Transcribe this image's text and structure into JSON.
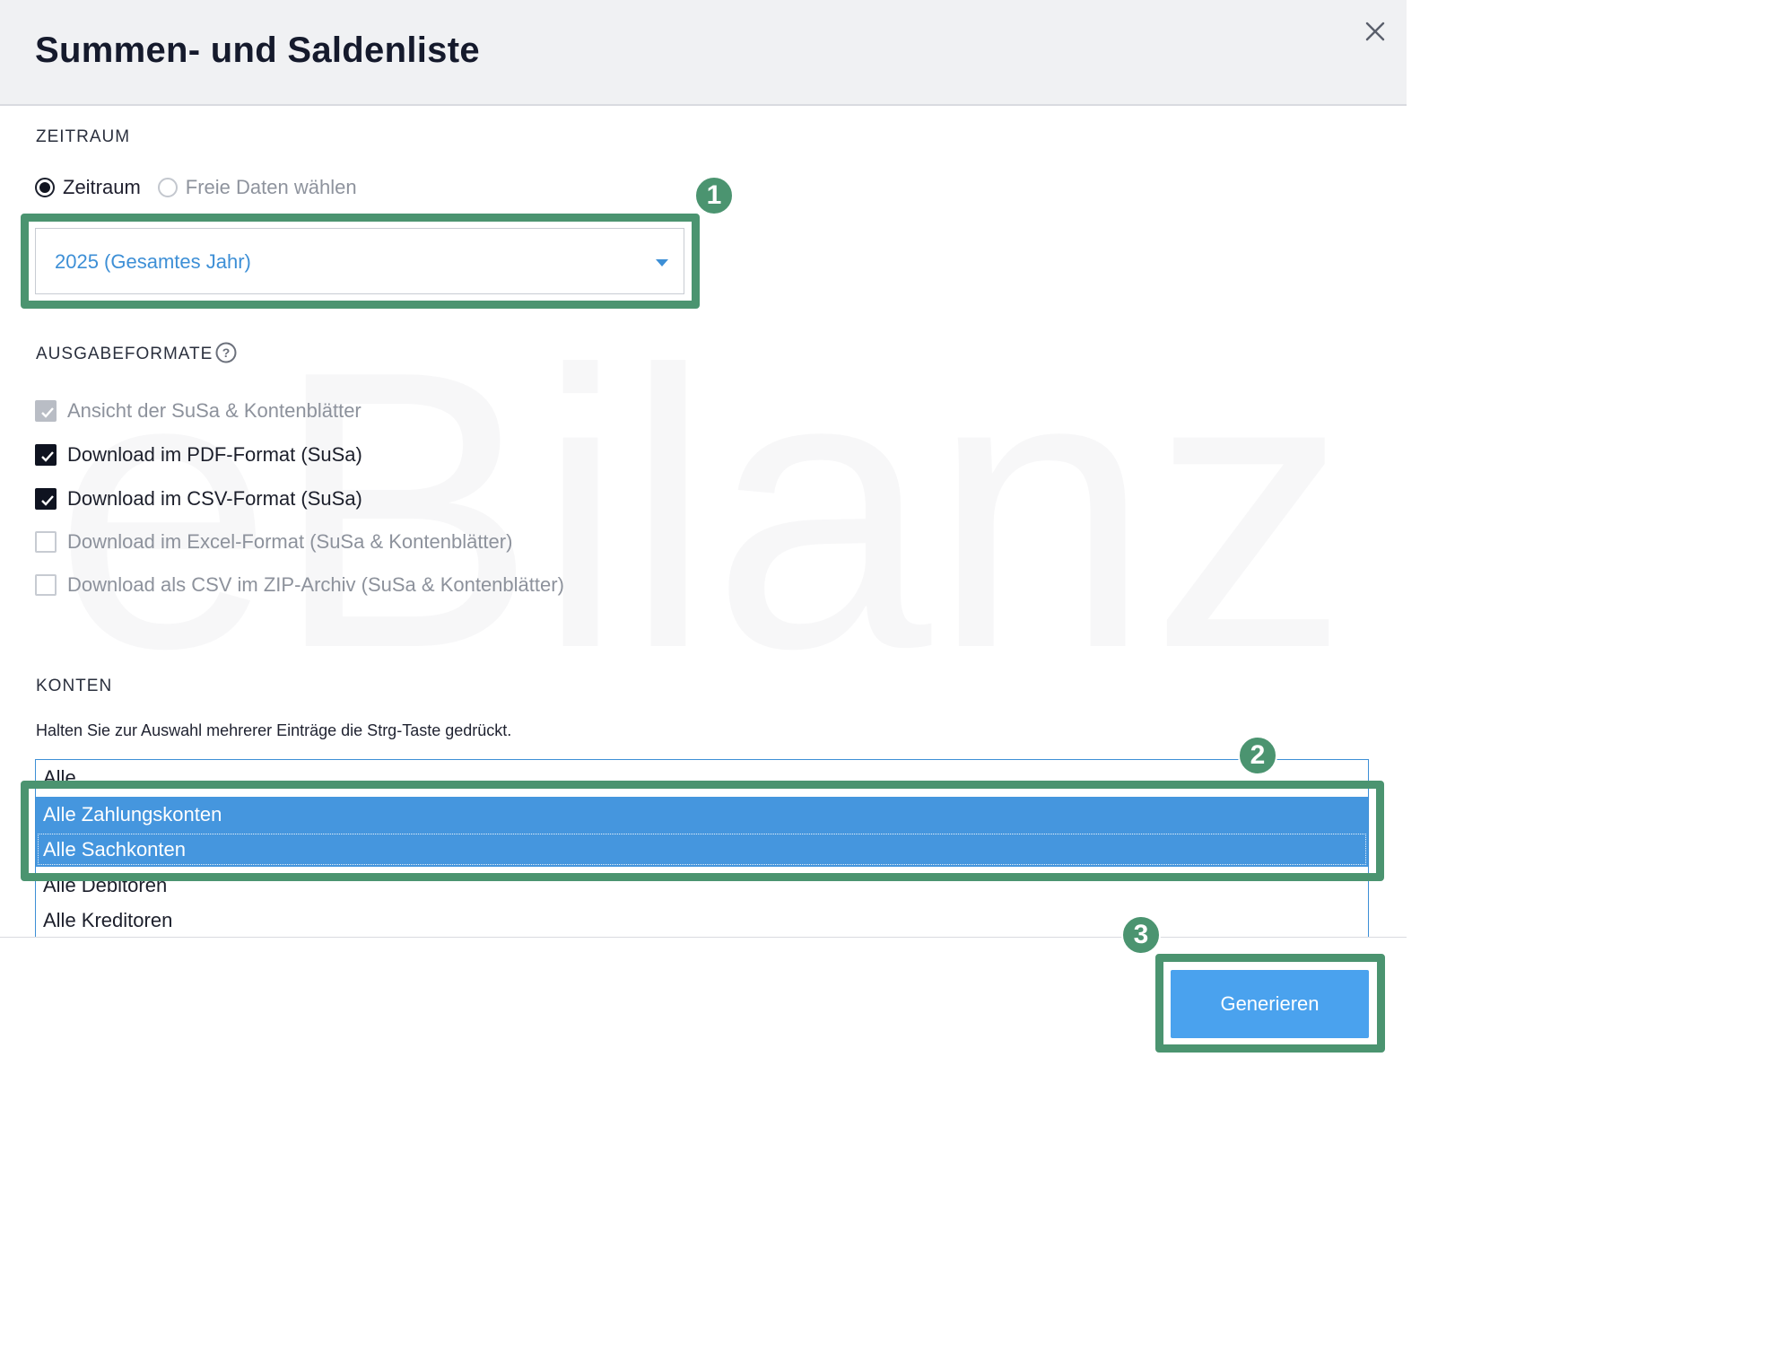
{
  "dialog": {
    "title": "Summen- und Saldenliste",
    "close_icon": "close-icon"
  },
  "zeitraum": {
    "section_label": "ZEITRAUM",
    "radio_options": [
      {
        "label": "Zeitraum",
        "checked": true
      },
      {
        "label": "Freie Daten wählen",
        "checked": false
      }
    ],
    "select_value": "2025 (Gesamtes Jahr)",
    "select_icon": "caret-down-icon"
  },
  "ausgabeformate": {
    "section_label": "AUSGABEFORMATE",
    "help_icon": "question-circle-icon",
    "options": [
      {
        "label": "Ansicht der SuSa & Kontenblätter",
        "checked": true,
        "disabled": true
      },
      {
        "label": "Download im PDF-Format (SuSa)",
        "checked": true,
        "disabled": false
      },
      {
        "label": "Download im CSV-Format (SuSa)",
        "checked": true,
        "disabled": false
      },
      {
        "label": "Download im Excel-Format (SuSa & Kontenblätter)",
        "checked": false,
        "disabled": false
      },
      {
        "label": "Download als CSV im ZIP-Archiv (SuSa & Kontenblätter)",
        "checked": false,
        "disabled": false
      }
    ]
  },
  "konten": {
    "section_label": "KONTEN",
    "hint": "Halten Sie zur Auswahl mehrerer Einträge die Strg-Taste gedrückt.",
    "options": [
      {
        "label": "Alle",
        "selected": false
      },
      {
        "label": "Alle Zahlungskonten",
        "selected": true
      },
      {
        "label": "Alle Sachkonten",
        "selected": true
      },
      {
        "label": "Alle Debitoren",
        "selected": false
      },
      {
        "label": "Alle Kreditoren",
        "selected": false
      }
    ]
  },
  "footer": {
    "generate_label": "Generieren"
  },
  "annotations": {
    "badges": [
      "1",
      "2",
      "3"
    ],
    "highlight_color": "#4b9470"
  },
  "watermark": {
    "text": "eBilanz+"
  },
  "colors": {
    "accent": "#3d8fd6",
    "selection": "#4596de",
    "button": "#4aa2ee"
  }
}
